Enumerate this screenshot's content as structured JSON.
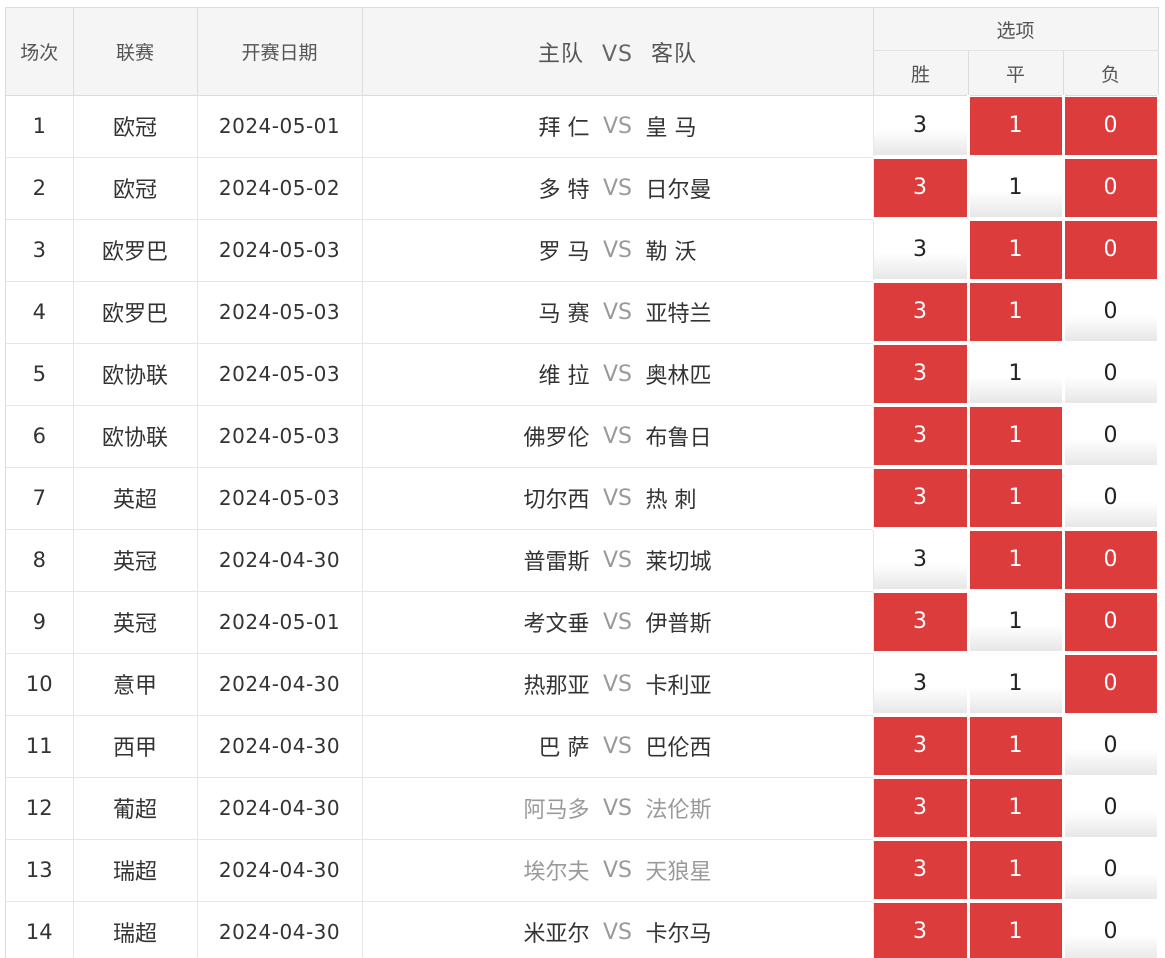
{
  "header": {
    "index": "场次",
    "league": "联赛",
    "date": "开赛日期",
    "match_home": "主队",
    "match_vs": "VS",
    "match_away": "客队",
    "options": "选项",
    "win": "胜",
    "draw": "平",
    "lose": "负"
  },
  "colors": {
    "selected": "#dc3c3c",
    "border": "#dcdcdc"
  },
  "rows": [
    {
      "index": "1",
      "league": "欧冠",
      "date": "2024-05-01",
      "home": "拜 仁",
      "vs": "VS",
      "away": "皇 马",
      "win": "3",
      "draw": "1",
      "lose": "0",
      "sel": [
        false,
        true,
        true
      ],
      "muted": false
    },
    {
      "index": "2",
      "league": "欧冠",
      "date": "2024-05-02",
      "home": "多 特",
      "vs": "VS",
      "away": "日尔曼",
      "win": "3",
      "draw": "1",
      "lose": "0",
      "sel": [
        true,
        false,
        true
      ],
      "muted": false
    },
    {
      "index": "3",
      "league": "欧罗巴",
      "date": "2024-05-03",
      "home": "罗 马",
      "vs": "VS",
      "away": "勒 沃",
      "win": "3",
      "draw": "1",
      "lose": "0",
      "sel": [
        false,
        true,
        true
      ],
      "muted": false
    },
    {
      "index": "4",
      "league": "欧罗巴",
      "date": "2024-05-03",
      "home": "马 赛",
      "vs": "VS",
      "away": "亚特兰",
      "win": "3",
      "draw": "1",
      "lose": "0",
      "sel": [
        true,
        true,
        false
      ],
      "muted": false
    },
    {
      "index": "5",
      "league": "欧协联",
      "date": "2024-05-03",
      "home": "维 拉",
      "vs": "VS",
      "away": "奥林匹",
      "win": "3",
      "draw": "1",
      "lose": "0",
      "sel": [
        true,
        false,
        false
      ],
      "muted": false
    },
    {
      "index": "6",
      "league": "欧协联",
      "date": "2024-05-03",
      "home": "佛罗伦",
      "vs": "VS",
      "away": "布鲁日",
      "win": "3",
      "draw": "1",
      "lose": "0",
      "sel": [
        true,
        true,
        false
      ],
      "muted": false
    },
    {
      "index": "7",
      "league": "英超",
      "date": "2024-05-03",
      "home": "切尔西",
      "vs": "VS",
      "away": "热 刺",
      "win": "3",
      "draw": "1",
      "lose": "0",
      "sel": [
        true,
        true,
        false
      ],
      "muted": false
    },
    {
      "index": "8",
      "league": "英冠",
      "date": "2024-04-30",
      "home": "普雷斯",
      "vs": "VS",
      "away": "莱切城",
      "win": "3",
      "draw": "1",
      "lose": "0",
      "sel": [
        false,
        true,
        true
      ],
      "muted": false
    },
    {
      "index": "9",
      "league": "英冠",
      "date": "2024-05-01",
      "home": "考文垂",
      "vs": "VS",
      "away": "伊普斯",
      "win": "3",
      "draw": "1",
      "lose": "0",
      "sel": [
        true,
        false,
        true
      ],
      "muted": false
    },
    {
      "index": "10",
      "league": "意甲",
      "date": "2024-04-30",
      "home": "热那亚",
      "vs": "VS",
      "away": "卡利亚",
      "win": "3",
      "draw": "1",
      "lose": "0",
      "sel": [
        false,
        false,
        true
      ],
      "muted": false
    },
    {
      "index": "11",
      "league": "西甲",
      "date": "2024-04-30",
      "home": "巴 萨",
      "vs": "VS",
      "away": "巴伦西",
      "win": "3",
      "draw": "1",
      "lose": "0",
      "sel": [
        true,
        true,
        false
      ],
      "muted": false
    },
    {
      "index": "12",
      "league": "葡超",
      "date": "2024-04-30",
      "home": "阿马多",
      "vs": "VS",
      "away": "法伦斯",
      "win": "3",
      "draw": "1",
      "lose": "0",
      "sel": [
        true,
        true,
        false
      ],
      "muted": true
    },
    {
      "index": "13",
      "league": "瑞超",
      "date": "2024-04-30",
      "home": "埃尔夫",
      "vs": "VS",
      "away": "天狼星",
      "win": "3",
      "draw": "1",
      "lose": "0",
      "sel": [
        true,
        true,
        false
      ],
      "muted": true
    },
    {
      "index": "14",
      "league": "瑞超",
      "date": "2024-04-30",
      "home": "米亚尔",
      "vs": "VS",
      "away": "卡尔马",
      "win": "3",
      "draw": "1",
      "lose": "0",
      "sel": [
        true,
        true,
        false
      ],
      "muted": false
    }
  ]
}
